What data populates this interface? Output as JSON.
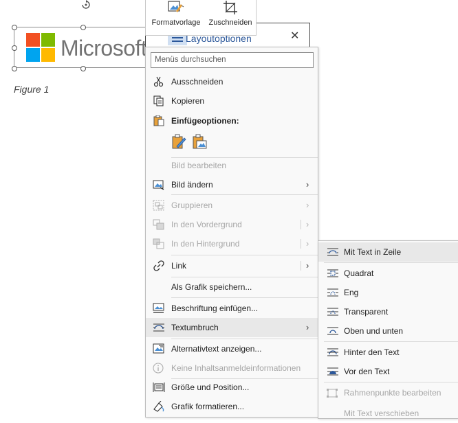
{
  "document": {
    "logo_text": "Microsoft",
    "caption": "Figure 1"
  },
  "mini_toolbar": {
    "style_label": "Formatvorlage",
    "crop_label": "Zuschneiden"
  },
  "layout_popup": {
    "title": "Layoutoptionen",
    "close_glyph": "✕"
  },
  "context_menu": {
    "search_placeholder": "Menüs durchsuchen",
    "items": {
      "cut": "Ausschneiden",
      "copy": "Kopieren",
      "paste_options": "Einfügeoptionen:",
      "edit_image": "Bild bearbeiten",
      "change_image": "Bild ändern",
      "group": "Gruppieren",
      "bring_front": "In den Vordergrund",
      "send_back": "In den Hintergrund",
      "link": "Link",
      "save_as_graphic": "Als Grafik speichern...",
      "insert_caption": "Beschriftung einfügen...",
      "text_wrap": "Textumbruch",
      "alt_text": "Alternativtext anzeigen...",
      "no_content_info": "Keine Inhaltsanmeldeinformationen",
      "size_position": "Größe und Position...",
      "format_graphic": "Grafik formatieren..."
    },
    "submenu_glyph": "›"
  },
  "wrap_submenu": {
    "in_line": "Mit Text in Zeile",
    "square": "Quadrat",
    "tight": "Eng",
    "through": "Transparent",
    "top_bottom": "Oben und unten",
    "behind": "Hinter den Text",
    "in_front": "Vor den Text",
    "edit_points": "Rahmenpunkte bearbeiten",
    "move_with_text": "Mit Text verschieben"
  },
  "colors": {
    "ms_red": "#f25022",
    "ms_green": "#7fba00",
    "ms_blue": "#00a4ef",
    "ms_yellow": "#ffb900",
    "accent_blue": "#2b579a",
    "hover": "#e8e8e8"
  }
}
